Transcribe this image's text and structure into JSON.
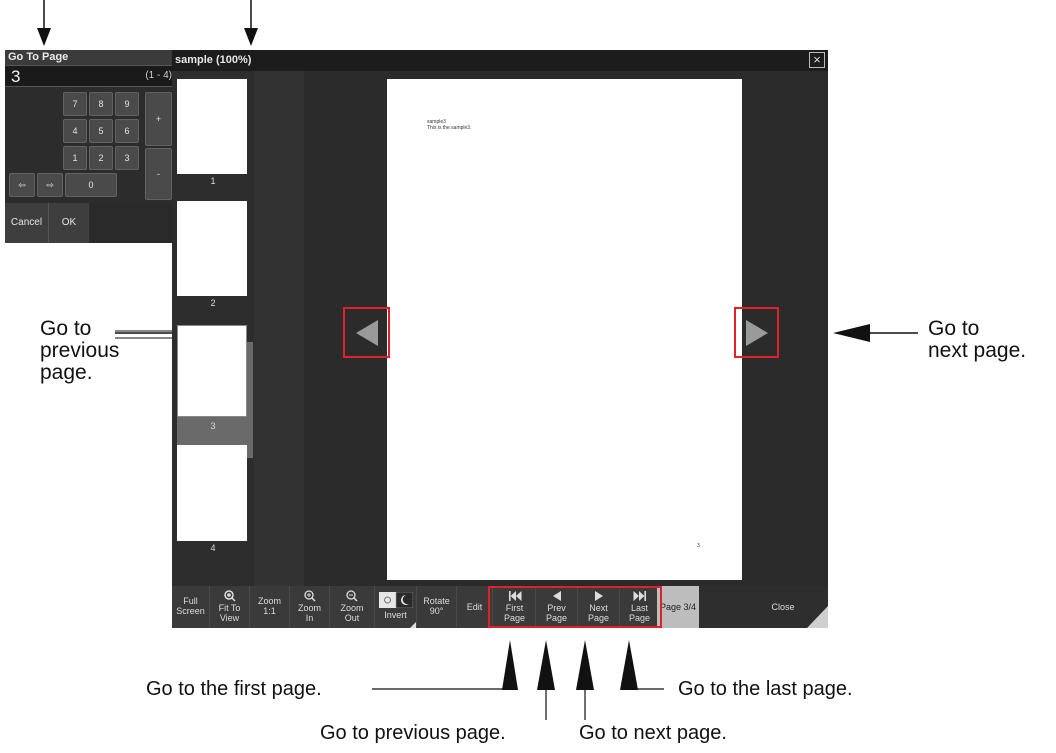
{
  "goto_panel": {
    "title": "Go To Page",
    "value": "3",
    "range": "(1 - 4)",
    "keys": [
      "7",
      "8",
      "9",
      "4",
      "5",
      "6",
      "1",
      "2",
      "3",
      "0"
    ],
    "plus": "+",
    "minus": "-",
    "left_arrow": "⇦",
    "right_arrow": "⇨",
    "cancel": "Cancel",
    "ok": "OK"
  },
  "viewer": {
    "title": "sample (100%)",
    "close_icon": "×",
    "thumbnails": [
      "1",
      "2",
      "3",
      "4"
    ],
    "selected_thumbnail": "3",
    "page_text_line1": "sample3",
    "page_text_line2": "This is the sample3.",
    "page_number": "3"
  },
  "toolbar": {
    "full_screen": [
      "Full",
      "Screen"
    ],
    "fit_to_view": [
      "Fit To",
      "View"
    ],
    "zoom_11": [
      "Zoom",
      "1:1"
    ],
    "zoom_in": [
      "Zoom",
      "In"
    ],
    "zoom_out": [
      "Zoom",
      "Out"
    ],
    "invert": "Invert",
    "rotate": [
      "Rotate",
      "90°"
    ],
    "edit": "Edit",
    "first_page": [
      "First",
      "Page"
    ],
    "prev_page": [
      "Prev",
      "Page"
    ],
    "next_page": [
      "Next",
      "Page"
    ],
    "last_page": [
      "Last",
      "Page"
    ],
    "page_indicator": "Page 3/4",
    "close": "Close"
  },
  "annotations": {
    "go_prev_left": [
      "Go to",
      "previous",
      "page."
    ],
    "go_next_right": [
      "Go to",
      "next page."
    ],
    "first_page": "Go to the first page.",
    "last_page": "Go to the last page.",
    "prev_page": "Go to previous page.",
    "next_page": "Go to next page."
  },
  "colors": {
    "highlight": "#e0202a",
    "panel": "#2c2c2c",
    "toolbar": "#3a3a3a"
  }
}
